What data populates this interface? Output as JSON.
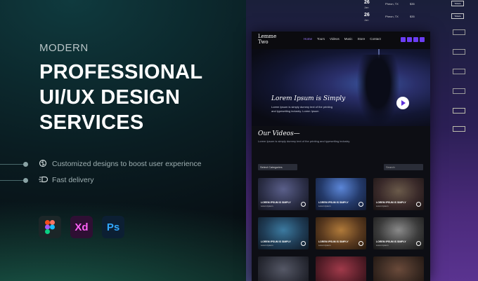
{
  "hero": {
    "eyebrow": "MODERN",
    "headline": [
      "PROFESSIONAL",
      "UI/UX DESIGN",
      "SERVICES"
    ]
  },
  "features": [
    {
      "icon": "brain-icon",
      "text": "Customized designs to boost user experience"
    },
    {
      "icon": "fast-delivery-icon",
      "text": "Fast delivery"
    }
  ],
  "tools": [
    {
      "name": "figma",
      "label": ""
    },
    {
      "name": "xd",
      "label": "Xd"
    },
    {
      "name": "ps",
      "label": "Ps"
    }
  ],
  "listpanel": {
    "rows": [
      {
        "day": "26",
        "month": "Jan",
        "city": "Pheon, TX",
        "venue": "$35",
        "button": "Tickets"
      },
      {
        "day": "26",
        "month": "Jan",
        "city": "Pheon, TX",
        "venue": "$35",
        "button": "Tickets"
      }
    ]
  },
  "mockup": {
    "logo_line1": "Lemme",
    "logo_line2": "Two",
    "nav": [
      "Home",
      "Tours",
      "Videos",
      "Music",
      "Store",
      "Contact"
    ],
    "nav_active": "Home",
    "hero_title": "Lorem Ipsum is Simply",
    "hero_desc": "Lorem Ipsum is simply dummy text of the printing and typesetting industry. Lorem Ipsum",
    "videos_title": "Our Videos—",
    "videos_sub": "Lorem Ipsum is simply dummy text of the printing and typesetting industry.",
    "filter_label": "Select Categories",
    "search_placeholder": "Search",
    "cards": [
      {
        "label": "LOREM IPSUM IS SIMPLY",
        "sub": "Lorem Ipsum",
        "color": "#2b2e46"
      },
      {
        "label": "LOREM IPSUM IS SIMPLY",
        "sub": "Lorem Ipsum",
        "color": "#243a6a"
      },
      {
        "label": "LOREM IPSUM IS SIMPLY",
        "sub": "Lorem Ipsum",
        "color": "#3a2a2a"
      },
      {
        "label": "LOREM IPSUM IS SIMPLY",
        "sub": "Lorem Ipsum",
        "color": "#1f3c55"
      },
      {
        "label": "LOREM IPSUM IS SIMPLY",
        "sub": "Lorem Ipsum",
        "color": "#5a3a1f"
      },
      {
        "label": "LOREM IPSUM IS SIMPLY",
        "sub": "Lorem Ipsum",
        "color": "#3c3c3c"
      },
      {
        "label": "",
        "sub": "",
        "color": "#2a2c36"
      },
      {
        "label": "",
        "sub": "",
        "color": "#5a1f2a"
      },
      {
        "label": "",
        "sub": "",
        "color": "#3a2a22"
      }
    ]
  },
  "colors": {
    "accent": "#6b3df5",
    "bg": "#070b10",
    "purple_panel": "#4a2a7a"
  }
}
